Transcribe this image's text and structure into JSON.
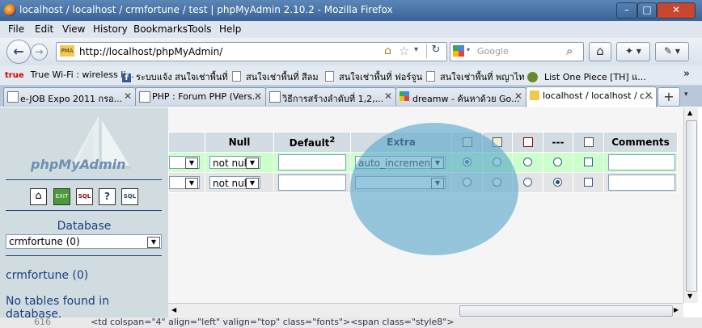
{
  "window": {
    "title": "localhost / localhost / crmfortune / test | phpMyAdmin 2.10.2 - Mozilla Firefox"
  },
  "menu": [
    "File",
    "Edit",
    "View",
    "History",
    "Bookmarks",
    "Tools",
    "Help"
  ],
  "nav": {
    "url": "http://localhost/phpMyAdmin/",
    "url_badge": "PMA",
    "search_placeholder": "Google"
  },
  "bookmarks": [
    {
      "icon": "true-logo",
      "label": "True Wi-Fi : wireless li..."
    },
    {
      "icon": "facebook-icon",
      "label": "ระบบแจ้ง สนใจเช่าพื้นที่"
    },
    {
      "icon": "page-icon",
      "label": "สนใจเช่าพื้นที่ สีลม"
    },
    {
      "icon": "page-icon",
      "label": "สนใจเช่าพื้นที่ ฟอร์จูน"
    },
    {
      "icon": "page-icon",
      "label": "สนใจเช่าพื้นที่ พญาไท"
    },
    {
      "icon": "onepiece-icon",
      "label": "List One Piece [TH] แ..."
    }
  ],
  "tabs": [
    {
      "label": "e-JOB Expo 2011 กรอ..."
    },
    {
      "label": "PHP : Forum PHP (Vers..."
    },
    {
      "label": "วิธีการสร้างลำดับที่ 1,2,..."
    },
    {
      "label": "dreamw - ค้นหาด้วย Go..."
    },
    {
      "label": "localhost / localhost / c..."
    }
  ],
  "sidebar": {
    "logo": "phpMyAdmin",
    "database_label": "Database",
    "database_selected": "crmfortune (0)",
    "db_link": "crmfortune (0)",
    "empty_msg": "No tables found in database."
  },
  "columns": {
    "null": "Null",
    "default": "Default",
    "default_sup": "2",
    "extra": "Extra",
    "dashes": "---",
    "comments": "Comments"
  },
  "rows": [
    {
      "null": "not null",
      "extra": "auto_increment",
      "radio": 0
    },
    {
      "null": "not null",
      "extra": "",
      "radio": 3
    }
  ],
  "source_line": {
    "num": "616",
    "code": "<td colspan=\"4\" align=\"left\" valign=\"top\" class=\"fonts\"><span class=\"style8\">"
  },
  "colors": {
    "header_bg": "#d3dce3",
    "row1_bg": "#ccffcc",
    "row2_bg": "#e5e5e5",
    "overlay": "#5faacd"
  }
}
